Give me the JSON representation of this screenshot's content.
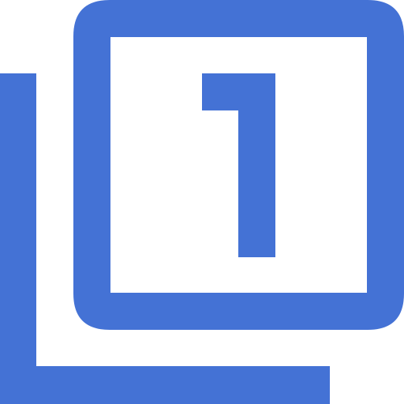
{
  "icon": {
    "name": "filter-1-icon",
    "digit_glyph": "1",
    "color": "#4472D5",
    "background": "#FFFFFF"
  }
}
